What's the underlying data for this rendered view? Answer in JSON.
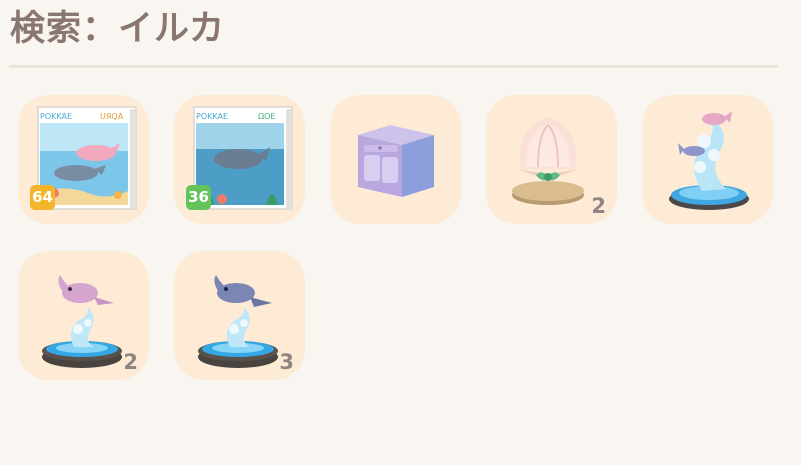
{
  "search": {
    "title": "検索：イルカ"
  },
  "items": [
    {
      "icon": "dolphin-book-pink-icon",
      "badge": "64",
      "badge_color": "#f2b52b",
      "count": ""
    },
    {
      "icon": "dolphin-book-blue-icon",
      "badge": "36",
      "badge_color": "#62c45a",
      "count": ""
    },
    {
      "icon": "dolphin-cabinet-icon",
      "badge": "",
      "count": ""
    },
    {
      "icon": "shell-ornament-icon",
      "badge": "",
      "count": "2"
    },
    {
      "icon": "dolphin-wave-statue-icon",
      "badge": "",
      "count": ""
    },
    {
      "icon": "pink-dolphin-statue-icon",
      "badge": "",
      "count": "2"
    },
    {
      "icon": "blue-dolphin-statue-icon",
      "badge": "",
      "count": "3"
    }
  ]
}
